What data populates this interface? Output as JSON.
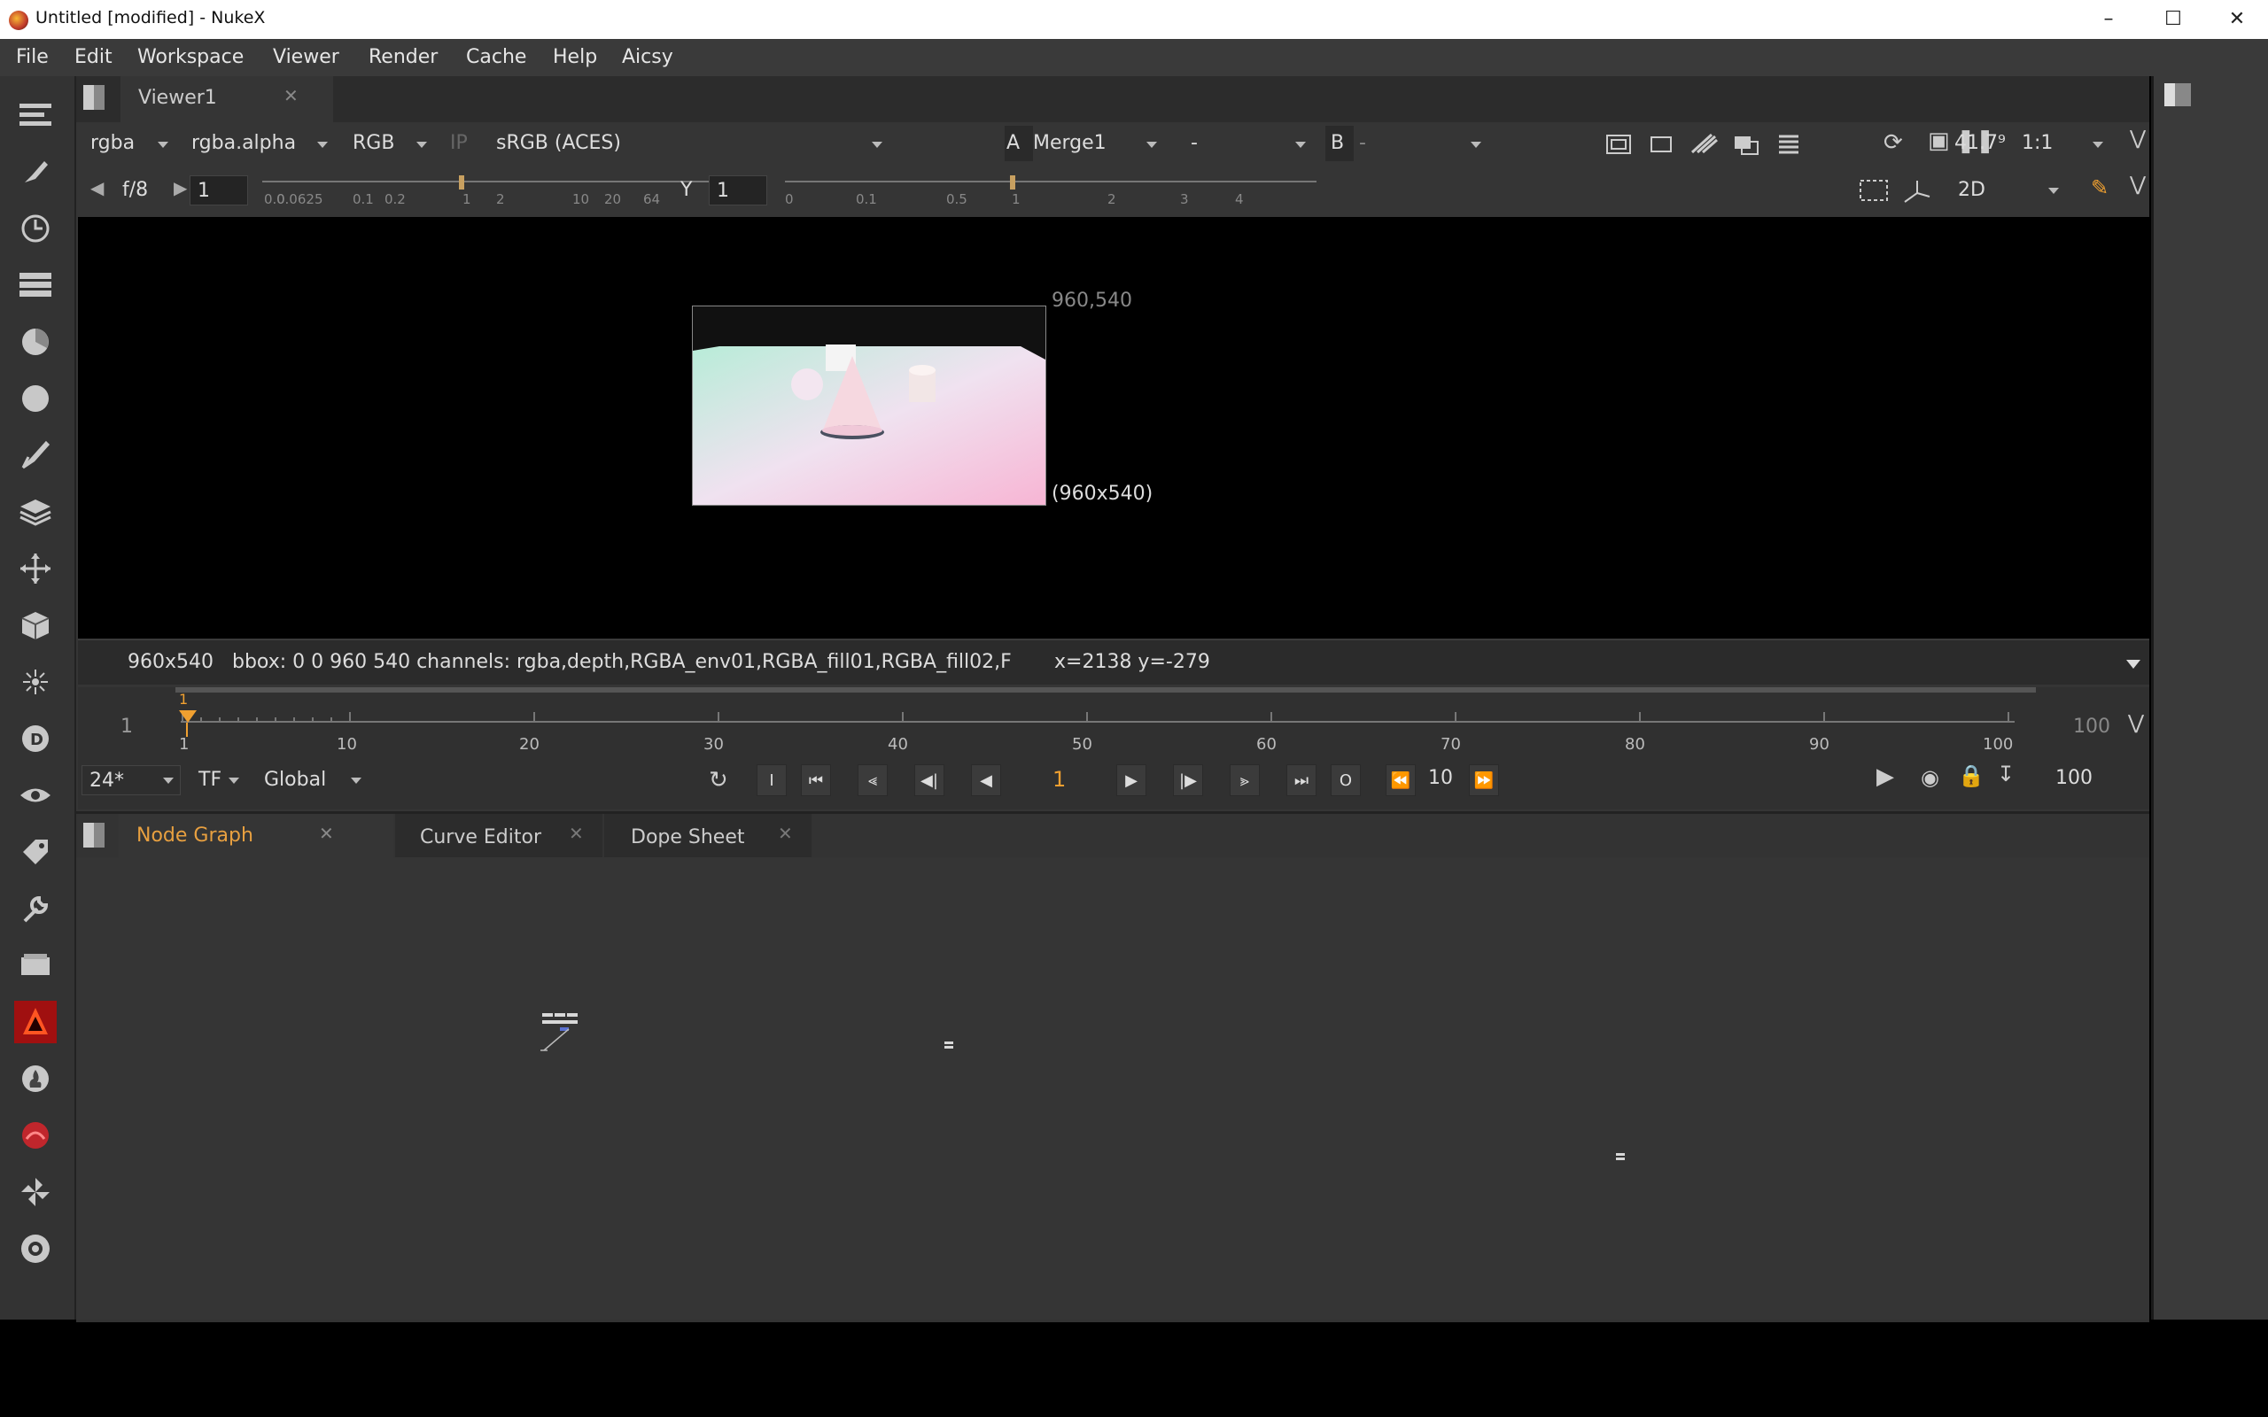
{
  "window": {
    "title": "Untitled [modified] - NukeX"
  },
  "menu": [
    "File",
    "Edit",
    "Workspace",
    "Viewer",
    "Render",
    "Cache",
    "Help",
    "Aicsy"
  ],
  "viewer_panel": {
    "tab_label": "Viewer1",
    "channels": "rgba",
    "alpha": "rgba.alpha",
    "display": "RGB",
    "ip_label": "IP",
    "colorspace": "sRGB (ACES)",
    "a_label": "A",
    "a_input": "Merge1",
    "op": "-",
    "b_label": "B",
    "b_input": "-",
    "zoom": "41.7⁹",
    "ratio": "1:1",
    "fstop": "f/8",
    "gain_value": "1",
    "gamma_label": "Y",
    "gamma_value": "1",
    "gain_ticks": [
      "0.0",
      "0.0625",
      "0.1",
      "0.2",
      "1",
      "2",
      "10",
      "20",
      "64"
    ],
    "gamma_ticks": [
      "0",
      "0.1",
      "0.5",
      "1",
      "2",
      "3",
      "4"
    ],
    "view_mode": "2D"
  },
  "image": {
    "format_label": "960,540",
    "size_label": "(960x540)"
  },
  "info_bar": {
    "text": "960x540   bbox: 0 0 960 540 channels: rgba,depth,RGBA_env01,RGBA_fill01,RGBA_fill02,F",
    "coords": "x=2138 y=-279"
  },
  "timeline": {
    "start": "1",
    "end": "100",
    "current_marker": "1",
    "ticks": [
      "1",
      "10",
      "20",
      "30",
      "40",
      "50",
      "60",
      "70",
      "80",
      "90",
      "100"
    ],
    "fps": "24*",
    "tf": "TF",
    "scope": "Global",
    "frame": "1",
    "step": "10",
    "out_frame": "100",
    "in_label": "I",
    "out_label": "O"
  },
  "node_panel": {
    "tabs": [
      {
        "label": "Node Graph",
        "active": true
      },
      {
        "label": "Curve Editor",
        "active": false
      },
      {
        "label": "Dope Sheet",
        "active": false
      }
    ]
  },
  "colors": {
    "accent": "#f0a030",
    "panel": "#353535",
    "active_tab": "#e8a040"
  }
}
